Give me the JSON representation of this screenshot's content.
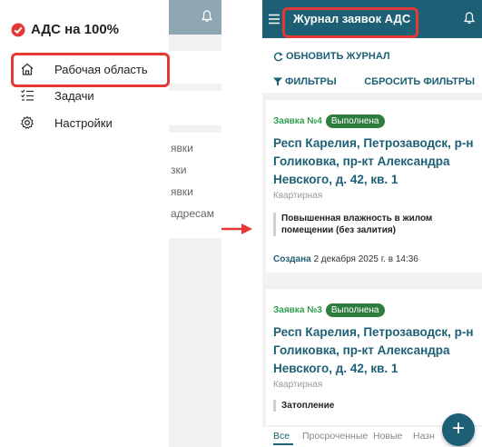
{
  "colors": {
    "accent": "#1d5f75",
    "highlight": "#e53935",
    "status_green": "#2e7d3e",
    "request_green": "#2e9e4f"
  },
  "left_screen": {
    "brand": {
      "title": "АДС на 100%",
      "icon": "check-badge-icon"
    },
    "nav": [
      {
        "label": "Рабочая область",
        "icon": "home-icon",
        "active": true
      },
      {
        "label": "Задачи",
        "icon": "list-icon",
        "active": false
      },
      {
        "label": "Настройки",
        "icon": "gear-icon",
        "active": false
      }
    ],
    "background_items": [
      "явки",
      "зки",
      "явки",
      "адресам"
    ]
  },
  "right_screen": {
    "header": {
      "title": "Журнал заявок АДС",
      "menu_icon": "hamburger-icon",
      "bell_icon": "bell-icon"
    },
    "toolbar": {
      "refresh_label": "ОБНОВИТЬ ЖУРНАЛ",
      "filters_label": "ФИЛЬТРЫ",
      "reset_label": "СБРОСИТЬ ФИЛЬТРЫ"
    },
    "requests": [
      {
        "number": "Заявка №4",
        "status": "Выполнена",
        "address": "Респ Карелия, Петрозаводск, р-н Голиковка, пр-кт Александра Невского, д. 42, кв. 1",
        "kind": "Квартирная",
        "description": "Повышенная влажность в жилом помещении (без залития)",
        "created_label": "Создана",
        "created_value": "2 декабря 2025 г. в 14:36"
      },
      {
        "number": "Заявка №3",
        "status": "Выполнена",
        "address": "Респ Карелия, Петрозаводск, р-н Голиковка, пр-кт Александра Невского, д. 42, кв. 1",
        "kind": "Квартирная",
        "description": "Затопление"
      }
    ],
    "tabs": [
      "Все",
      "Просроченные",
      "Новые",
      "Назн"
    ],
    "fab_label": "+"
  }
}
